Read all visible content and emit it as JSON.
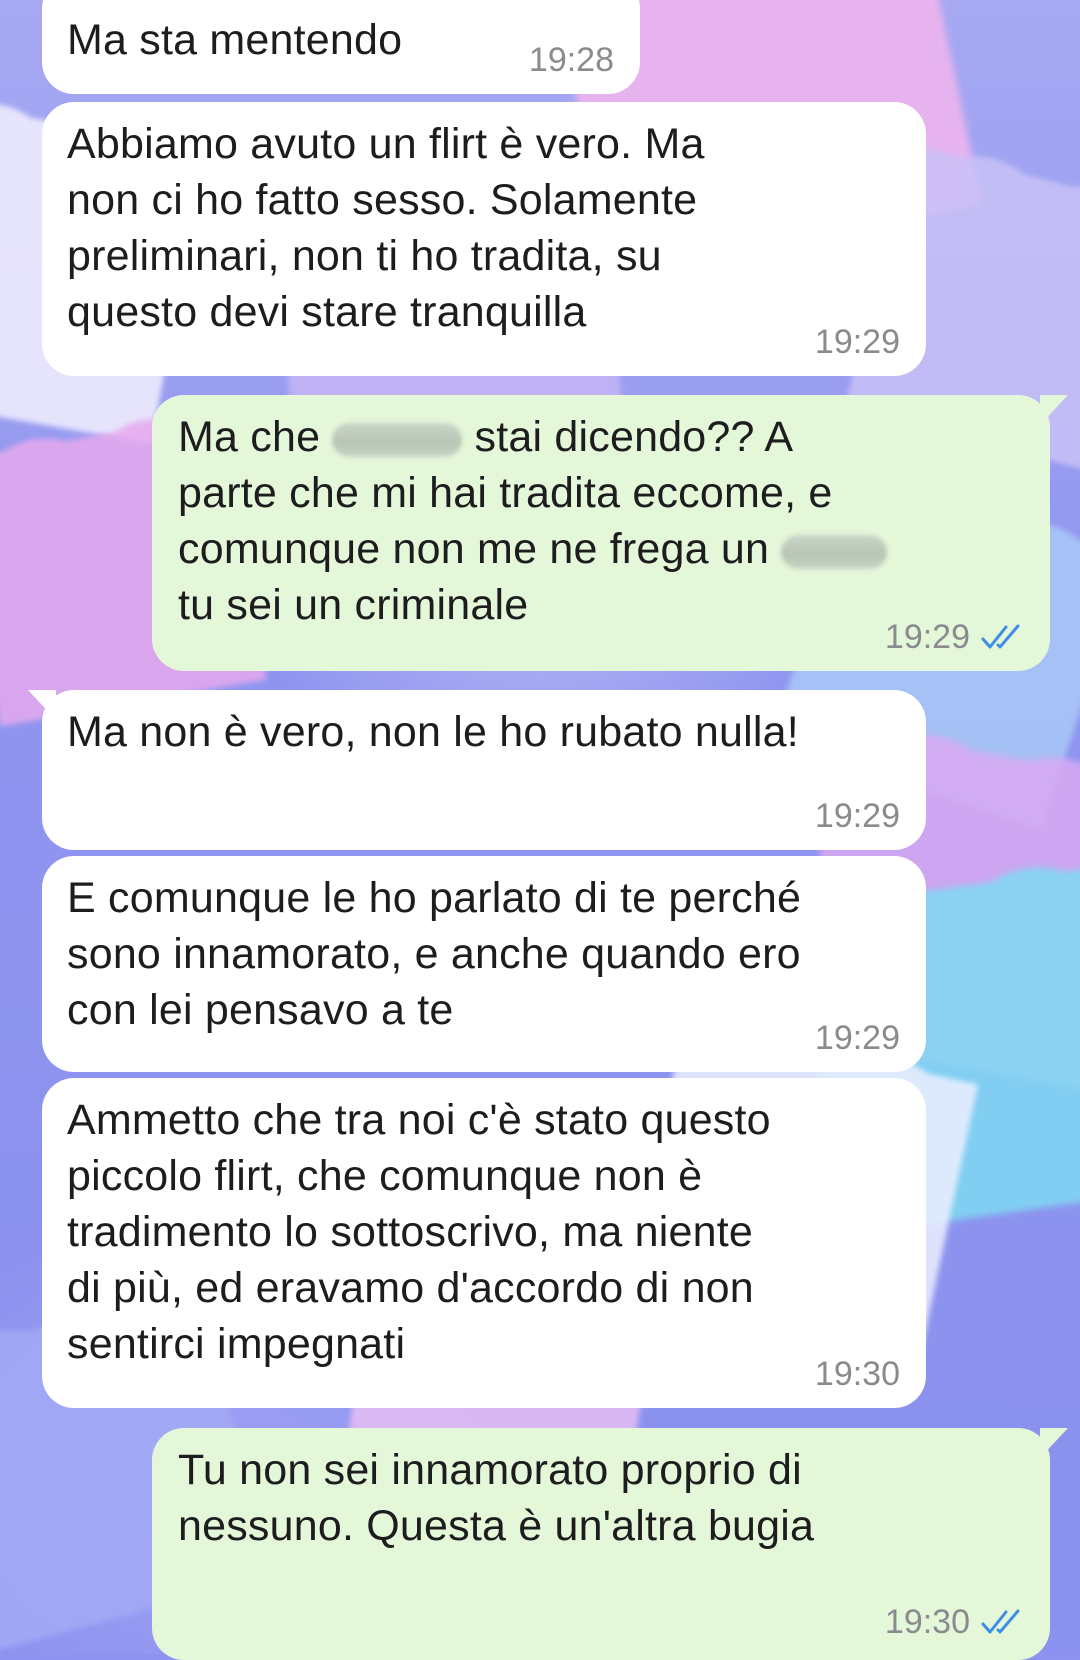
{
  "wallpaper": {
    "colors": {
      "base": "#8d93ee",
      "pink": "#f1b8ef",
      "blue": "#a9d4f7",
      "cyan": "#7fd9f3",
      "lilac": "#d5a9f0"
    }
  },
  "colors": {
    "incoming": "#ffffff",
    "outgoing": "#e4f7d9",
    "read_ticks": "#3d8ee6",
    "time": "#8a8a8f"
  },
  "messages": [
    {
      "direction": "incoming",
      "lines": [
        "Ma sta mentendo"
      ],
      "time": "19:28"
    },
    {
      "direction": "incoming",
      "lines": [
        "Abbiamo avuto un flirt è vero. Ma",
        "non ci ho fatto sesso. Solamente",
        "preliminari, non ti ho tradita, su",
        "questo devi stare tranquilla"
      ],
      "time": "19:29"
    },
    {
      "direction": "outgoing",
      "line1_before": "Ma che",
      "line1_after": "stai dicendo?? A",
      "line2": "parte che mi hai tradita eccome, e",
      "line3": "comunque non me ne frega un",
      "line4": "tu sei un criminale",
      "time": "19:29",
      "status_icon": "double-check-read-icon"
    },
    {
      "direction": "incoming",
      "lines": [
        "Ma non è vero, non le ho rubato nulla!"
      ],
      "time": "19:29"
    },
    {
      "direction": "incoming",
      "lines": [
        "E comunque le ho parlato di te perché",
        "sono innamorato, e anche quando ero",
        "con lei pensavo a te"
      ],
      "time": "19:29"
    },
    {
      "direction": "incoming",
      "lines": [
        "Ammetto che tra noi c'è stato questo",
        "piccolo flirt, che comunque non è",
        "tradimento lo sottoscrivo, ma niente",
        "di più, ed eravamo d'accordo di non",
        "sentirci impegnati"
      ],
      "time": "19:30"
    },
    {
      "direction": "outgoing",
      "lines": [
        "Tu non sei innamorato proprio di",
        "nessuno. Questa è un'altra bugia"
      ],
      "time": "19:30",
      "status_icon": "double-check-read-icon"
    }
  ]
}
